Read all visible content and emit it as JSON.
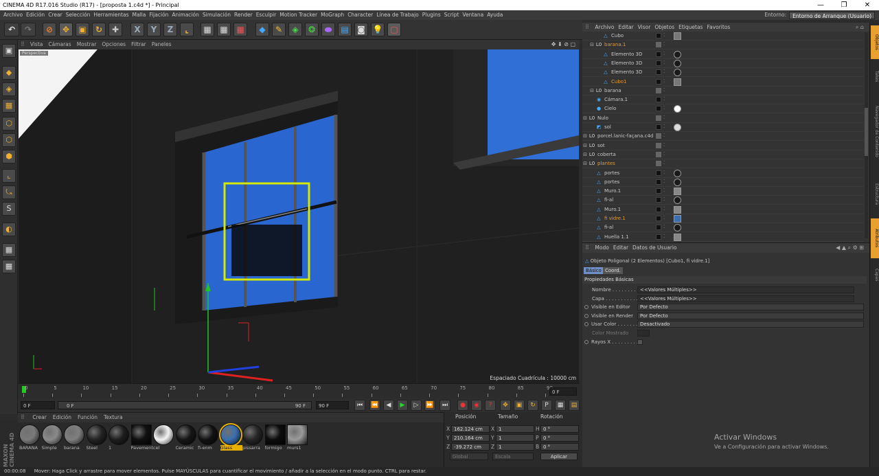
{
  "window": {
    "title": "CINEMA 4D R17.016 Studio (R17) - [proposta 1.c4d *] - Principal",
    "minimize": "—",
    "restore": "❐",
    "close": "✕"
  },
  "menubar": {
    "items": [
      "Archivo",
      "Edición",
      "Crear",
      "Selección",
      "Herramientas",
      "Malla",
      "Fijación",
      "Animación",
      "Simulación",
      "Render",
      "Esculpir",
      "Motion Tracker",
      "MoGraph",
      "Character",
      "Línea de Trabajo",
      "Plugins",
      "Script",
      "Ventana",
      "Ayuda"
    ],
    "entorno_label": "Entorno:",
    "entorno_value": "Entorno de Arranque (Usuario)"
  },
  "viewport": {
    "menu": [
      "Vista",
      "Cámaras",
      "Mostrar",
      "Opciones",
      "Filtrar",
      "Paneles"
    ],
    "label": "Perspectiva",
    "grid_spacing": "Espaciado Cuadrícula : 10000 cm"
  },
  "timeline": {
    "ticks": [
      "0",
      "5",
      "10",
      "15",
      "20",
      "25",
      "30",
      "35",
      "40",
      "45",
      "50",
      "55",
      "60",
      "65",
      "70",
      "75",
      "80",
      "85",
      "90"
    ],
    "current_frame": "0 F",
    "start_frame": "0 F",
    "min_frame": "0 F",
    "max_frame": "90 F",
    "end_frame": "90 F"
  },
  "materials": {
    "menu": [
      "Crear",
      "Edición",
      "Función",
      "Textura"
    ],
    "logo": "MAXON CINEMA 4D",
    "items": [
      {
        "label": "BARANA",
        "color": "#7a7a7a"
      },
      {
        "label": "Simple",
        "color": "#8a8a8a"
      },
      {
        "label": "barana",
        "color": "#7f7f7f"
      },
      {
        "label": "Steel",
        "color": "#222222"
      },
      {
        "label": "1",
        "color": "#1e1e1e"
      },
      {
        "label": "Pavement",
        "color": "#101010"
      },
      {
        "label": "cel",
        "color": "#f4f4f4"
      },
      {
        "label": "Ceramic",
        "color": "#161616"
      },
      {
        "label": "fi-enm",
        "color": "#121212"
      },
      {
        "label": "Glass",
        "color": "#3a6fb0"
      },
      {
        "label": "pissarra",
        "color": "#262626"
      },
      {
        "label": "formigo",
        "color": "#0c0c0c"
      },
      {
        "label": "murs1",
        "color": "#9a9a9a"
      }
    ]
  },
  "coordinates": {
    "headers": [
      "Posición",
      "Tamaño",
      "Rotación"
    ],
    "rows": [
      {
        "axis": "X",
        "pos": "162.124 cm",
        "size_axis": "X",
        "size": "1",
        "rot_axis": "H",
        "rot": "0 °"
      },
      {
        "axis": "Y",
        "pos": "210.164 cm",
        "size_axis": "Y",
        "size": "1",
        "rot_axis": "P",
        "rot": "0 °"
      },
      {
        "axis": "Z",
        "pos": "-39.272 cm",
        "size_axis": "Z",
        "size": "1",
        "rot_axis": "B",
        "rot": "0 °"
      }
    ],
    "mode1": "Global",
    "mode2": "Escala",
    "apply": "Aplicar"
  },
  "objects": {
    "menu": [
      "Archivo",
      "Editar",
      "Visor",
      "Objetos",
      "Etiquetas",
      "Favoritos"
    ],
    "rows": [
      {
        "indent": 2,
        "name": "Cubo",
        "icon": "△",
        "orange": false,
        "tag": "#777777"
      },
      {
        "indent": 1,
        "name": "barana.1",
        "icon": "L0",
        "orange": true,
        "tag": ""
      },
      {
        "indent": 2,
        "name": "Elemento 3D",
        "icon": "△",
        "orange": false,
        "tag": "#1a1a1a"
      },
      {
        "indent": 2,
        "name": "Elemento 3D",
        "icon": "△",
        "orange": false,
        "tag": "#1a1a1a"
      },
      {
        "indent": 2,
        "name": "Elemento 3D",
        "icon": "△",
        "orange": false,
        "tag": "#1a1a1a"
      },
      {
        "indent": 2,
        "name": "Cubo1",
        "icon": "△",
        "orange": true,
        "tag": "#777777"
      },
      {
        "indent": 1,
        "name": "barana",
        "icon": "L0",
        "orange": false,
        "tag": ""
      },
      {
        "indent": 1,
        "name": "Cámara.1",
        "icon": "◉",
        "orange": false,
        "tag": ""
      },
      {
        "indent": 1,
        "name": "Cielo",
        "icon": "●",
        "orange": false,
        "tag": "#ffffff"
      },
      {
        "indent": 0,
        "name": "Nulo",
        "icon": "L0",
        "orange": false,
        "tag": ""
      },
      {
        "indent": 1,
        "name": "sol",
        "icon": "◩",
        "orange": false,
        "tag": "#dddddd"
      },
      {
        "indent": 0,
        "name": "porcel.lanic-façana.c4d",
        "icon": "L0",
        "orange": false,
        "tag": ""
      },
      {
        "indent": 0,
        "name": "sot",
        "icon": "L0",
        "orange": false,
        "tag": ""
      },
      {
        "indent": 0,
        "name": "coberta",
        "icon": "L0",
        "orange": false,
        "tag": ""
      },
      {
        "indent": 0,
        "name": "plantes",
        "icon": "L0",
        "orange": true,
        "tag": ""
      },
      {
        "indent": 1,
        "name": "portes",
        "icon": "△",
        "orange": false,
        "tag": "#1a1a1a"
      },
      {
        "indent": 1,
        "name": "portes",
        "icon": "△",
        "orange": false,
        "tag": "#1a1a1a"
      },
      {
        "indent": 1,
        "name": "Muro.1",
        "icon": "△",
        "orange": false,
        "tag": "#888888"
      },
      {
        "indent": 1,
        "name": "fi-al",
        "icon": "△",
        "orange": false,
        "tag": "#1a1a1a"
      },
      {
        "indent": 1,
        "name": "Muro.1",
        "icon": "△",
        "orange": false,
        "tag": "#888888"
      },
      {
        "indent": 1,
        "name": "fi vidre.1",
        "icon": "△",
        "orange": true,
        "tag": "#3a6fb0"
      },
      {
        "indent": 1,
        "name": "fi-al",
        "icon": "△",
        "orange": false,
        "tag": "#1a1a1a"
      },
      {
        "indent": 1,
        "name": "Huella 1.1",
        "icon": "△",
        "orange": false,
        "tag": "#888888"
      }
    ]
  },
  "attributes": {
    "menu": [
      "Modo",
      "Editar",
      "Datos de Usuario"
    ],
    "object_title": "Objeto Poligonal (2 Elementos) [Cubo1, fi vidre.1]",
    "tabs": [
      "Básico",
      "Coord."
    ],
    "section": "Propiedades Básicas",
    "rows": [
      {
        "label": "Nombre . . . . . . . . . . . .",
        "value": "<<Valores Múltiples>>",
        "radio": false
      },
      {
        "label": "Capa . . . . . . . . . . . . . .",
        "value": "<<Valores Múltiples>>",
        "radio": false
      },
      {
        "label": "Visible en Editor",
        "value": "Por Defecto",
        "radio": true
      },
      {
        "label": "Visible en Render",
        "value": "Por Defecto",
        "radio": true
      },
      {
        "label": "Usar Color . . . . . . . .",
        "value": "Desactivado",
        "radio": true
      },
      {
        "label": "Color Mostrado",
        "value": "",
        "radio": false
      },
      {
        "label": "Rayos X . . . . . . . . . .",
        "value": "",
        "radio": true
      }
    ]
  },
  "side_tabs": [
    "Objetos",
    "Takes",
    "Navegador de Contenido",
    "Estructura",
    "Atributos",
    "Capas"
  ],
  "status": {
    "time": "00:00:08",
    "text": "Mover: Haga Click y arrastre para mover elementos. Pulse MAYÚSCULAS para cuantificar el movimiento / añadir a la selección en el modo punto. CTRL para restar."
  },
  "activation": {
    "title": "Activar Windows",
    "subtitle": "Ve a Configuración para activar Windows."
  },
  "colors": {
    "selection_box": "#d4e800",
    "sky": "#2f6fd6",
    "accent_orange": "#e89a30"
  }
}
